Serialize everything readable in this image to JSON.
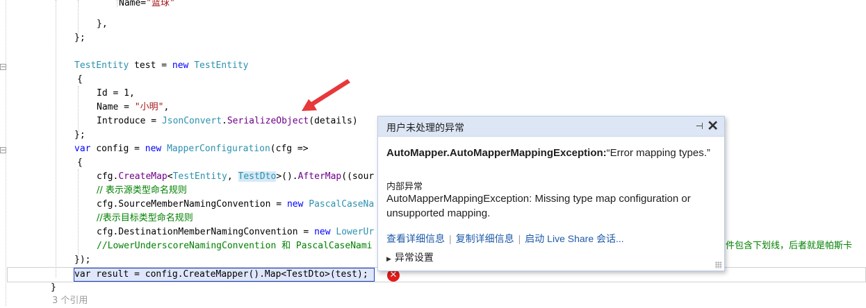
{
  "code": {
    "l1": {
      "prefix": "Name=",
      "str": "\"篮球\""
    },
    "l2": "},",
    "l3": "};",
    "l4": {
      "type1": "TestEntity",
      "var": " test = ",
      "kw": "new",
      "type2": " TestEntity"
    },
    "l5": "{",
    "l6": "Id = 1,",
    "l7": {
      "prefix": "Name = ",
      "str": "\"小明\"",
      "suffix": ","
    },
    "l8": {
      "prefix": "Introduce = ",
      "type": "JsonConvert",
      "dot": ".",
      "method": "SerializeObject",
      "suffix": "(details)"
    },
    "l9": "};",
    "l10": {
      "kw": "var",
      "mid": " config = ",
      "kw2": "new",
      "type": " MapperConfiguration",
      "suffix": "(cfg =>"
    },
    "l11": "{",
    "l12": {
      "prefix": "cfg.",
      "method": "CreateMap",
      "lt": "<",
      "t1": "TestEntity",
      "comma": ", ",
      "t2": "TestDto",
      "gt": ">().",
      "method2": "AfterMap",
      "suffix": "((sour"
    },
    "l13": "// 表示源类型命名规则",
    "l14": {
      "prefix": "cfg.SourceMemberNamingConvention = ",
      "kw": "new",
      "type": " PascalCaseNa"
    },
    "l15": "//表示目标类型命名规则",
    "l16": {
      "prefix": "cfg.DestinationMemberNamingConvention = ",
      "kw": "new",
      "type": " LowerUr"
    },
    "l17": "//LowerUnderscoreNamingConvention 和 PascalCaseNami",
    "l17_tail": "件包含下划线，后者就是帕斯卡",
    "l18": "});",
    "l19": "var result = config.CreateMapper().Map<TestDto>(test);",
    "l20": "}",
    "refs": "3 个引用"
  },
  "popup": {
    "title": "用户未处理的异常",
    "exception_type": "AutoMapper.AutoMapperMappingException:",
    "exception_msg": "“Error mapping types.”",
    "inner_label": "内部异常",
    "inner_msg": "AutoMapperMappingException: Missing type map configuration or unsupported mapping.",
    "links": [
      "查看详细信息",
      "复制详细信息",
      "启动 Live Share 会话..."
    ],
    "settings": "异常设置",
    "pin_icon": "pin-icon",
    "close_icon": "close-icon"
  },
  "error_icon": "error-icon"
}
